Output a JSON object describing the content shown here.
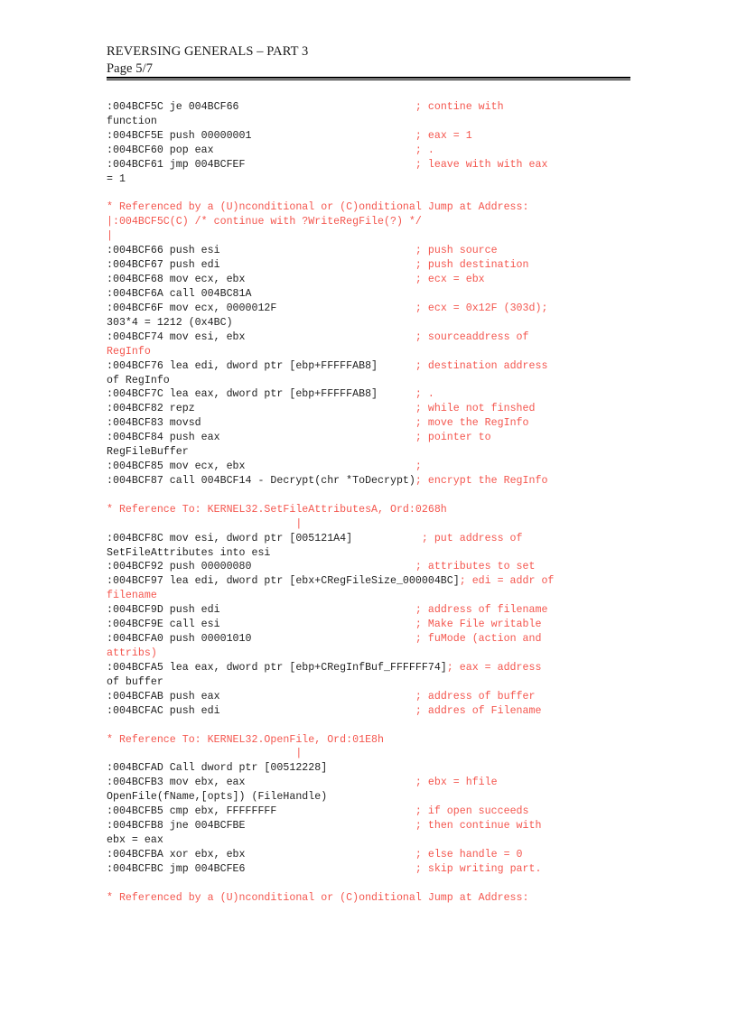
{
  "header": {
    "title": "REVERSING GENERALS – PART 3",
    "page_label": "Page 5/7"
  },
  "listing": {
    "comment_color": "#f4564e",
    "code_color": "#222222",
    "lines": [
      {
        "kind": "code",
        "asm": ":004BCF5C je 004BCF66",
        "comment": "; contine with"
      },
      {
        "kind": "wrap",
        "color": "black",
        "text": "function"
      },
      {
        "kind": "code",
        "asm": ":004BCF5E push 00000001",
        "comment": "; eax = 1"
      },
      {
        "kind": "code",
        "asm": ":004BCF60 pop eax",
        "comment": "; ."
      },
      {
        "kind": "code",
        "asm": ":004BCF61 jmp 004BCFEF",
        "comment": "; leave with with eax"
      },
      {
        "kind": "wrap",
        "color": "black",
        "text": "= 1"
      },
      {
        "kind": "blank"
      },
      {
        "kind": "ref",
        "text": "* Referenced by a (U)nconditional or (C)onditional Jump at Address:"
      },
      {
        "kind": "ref",
        "text": "|:004BCF5C(C) /* continue with ?WriteRegFile(?) */"
      },
      {
        "kind": "ref",
        "text": "|"
      },
      {
        "kind": "code",
        "asm": ":004BCF66 push esi",
        "comment": "; push source"
      },
      {
        "kind": "code",
        "asm": ":004BCF67 push edi",
        "comment": "; push destination"
      },
      {
        "kind": "code",
        "asm": ":004BCF68 mov ecx, ebx",
        "comment": "; ecx = ebx"
      },
      {
        "kind": "code",
        "asm": ":004BCF6A call 004BC81A",
        "comment": ""
      },
      {
        "kind": "code",
        "asm": ":004BCF6F mov ecx, 0000012F",
        "comment": "; ecx = 0x12F (303d);"
      },
      {
        "kind": "wrap",
        "color": "black",
        "text": "303*4 = 1212 (0x4BC)"
      },
      {
        "kind": "code",
        "asm": ":004BCF74 mov esi, ebx",
        "comment": "; sourceaddress of"
      },
      {
        "kind": "wrap",
        "color": "red",
        "text": "RegInfo"
      },
      {
        "kind": "code",
        "asm": ":004BCF76 lea edi, dword ptr [ebp+FFFFFAB8]",
        "comment": "; destination address"
      },
      {
        "kind": "wrap",
        "color": "black",
        "text": "of RegInfo"
      },
      {
        "kind": "code",
        "asm": ":004BCF7C lea eax, dword ptr [ebp+FFFFFAB8]",
        "comment": "; ."
      },
      {
        "kind": "code",
        "asm": ":004BCF82 repz",
        "comment": "; while not finshed"
      },
      {
        "kind": "code",
        "asm": ":004BCF83 movsd",
        "comment": "; move the RegInfo"
      },
      {
        "kind": "code",
        "asm": ":004BCF84 push eax",
        "comment": "; pointer to"
      },
      {
        "kind": "wrap",
        "color": "black",
        "text": "RegFileBuffer"
      },
      {
        "kind": "code",
        "asm": ":004BCF85 mov ecx, ebx",
        "comment": ";"
      },
      {
        "kind": "code",
        "asm": ":004BCF87 call 004BCF14 - Decrypt(chr *ToDecrypt)",
        "comment": "; encrypt the RegInfo",
        "tight": true
      },
      {
        "kind": "blank"
      },
      {
        "kind": "ref",
        "text": "* Reference To: KERNEL32.SetFileAttributesA, Ord:0268h"
      },
      {
        "kind": "ref",
        "text": "                              |"
      },
      {
        "kind": "code",
        "asm": ":004BCF8C mov esi, dword ptr [005121A4]",
        "comment": "; put address of",
        "col": 50
      },
      {
        "kind": "wrap",
        "color": "black",
        "text": "SetFileAttributes into esi"
      },
      {
        "kind": "code",
        "asm": ":004BCF92 push 00000080",
        "comment": "; attributes to set"
      },
      {
        "kind": "code",
        "asm": ":004BCF97 lea edi, dword ptr [ebx+CRegFileSize_000004BC]",
        "comment": "; edi = addr of",
        "tight": true
      },
      {
        "kind": "wrap",
        "color": "red",
        "text": "filename"
      },
      {
        "kind": "code",
        "asm": ":004BCF9D push edi",
        "comment": "; address of filename"
      },
      {
        "kind": "code",
        "asm": ":004BCF9E call esi",
        "comment": "; Make File writable"
      },
      {
        "kind": "code",
        "asm": ":004BCFA0 push 00001010",
        "comment": "; fuMode (action and"
      },
      {
        "kind": "wrap",
        "color": "red",
        "text": "attribs)"
      },
      {
        "kind": "code",
        "asm": ":004BCFA5 lea eax, dword ptr [ebp+CRegInfBuf_FFFFFF74]",
        "comment": "; eax = address",
        "tight": true
      },
      {
        "kind": "wrap",
        "color": "black",
        "text": "of buffer"
      },
      {
        "kind": "code",
        "asm": ":004BCFAB push eax",
        "comment": "; address of buffer"
      },
      {
        "kind": "code",
        "asm": ":004BCFAC push edi",
        "comment": "; addres of Filename"
      },
      {
        "kind": "blank"
      },
      {
        "kind": "ref",
        "text": "* Reference To: KERNEL32.OpenFile, Ord:01E8h"
      },
      {
        "kind": "ref",
        "text": "                              |"
      },
      {
        "kind": "code",
        "asm": ":004BCFAD Call dword ptr [00512228]",
        "comment": ""
      },
      {
        "kind": "code",
        "asm": ":004BCFB3 mov ebx, eax",
        "comment": "; ebx = hfile"
      },
      {
        "kind": "wrap",
        "color": "black",
        "text": "OpenFile(fName,[opts]) (FileHandle)"
      },
      {
        "kind": "code",
        "asm": ":004BCFB5 cmp ebx, FFFFFFFF",
        "comment": "; if open succeeds"
      },
      {
        "kind": "code",
        "asm": ":004BCFB8 jne 004BCFBE",
        "comment": "; then continue with"
      },
      {
        "kind": "wrap",
        "color": "black",
        "text": "ebx = eax"
      },
      {
        "kind": "code",
        "asm": ":004BCFBA xor ebx, ebx",
        "comment": "; else handle = 0"
      },
      {
        "kind": "code",
        "asm": ":004BCFBC jmp 004BCFE6",
        "comment": "; skip writing part."
      },
      {
        "kind": "blank"
      },
      {
        "kind": "ref",
        "text": "* Referenced by a (U)nconditional or (C)onditional Jump at Address:"
      }
    ]
  }
}
